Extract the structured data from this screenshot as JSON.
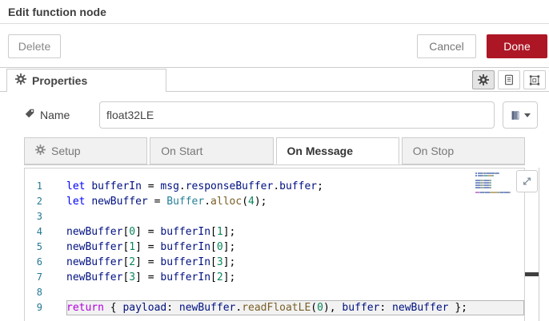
{
  "window": {
    "title": "Edit function node"
  },
  "toolbar": {
    "delete": "Delete",
    "cancel": "Cancel",
    "done": "Done"
  },
  "properties": {
    "label": "Properties"
  },
  "name_field": {
    "label": "Name",
    "value": "float32LE"
  },
  "tabs": [
    {
      "label": "Setup",
      "has_icon": true,
      "active": false
    },
    {
      "label": "On Start",
      "has_icon": false,
      "active": false
    },
    {
      "label": "On Message",
      "has_icon": false,
      "active": true
    },
    {
      "label": "On Stop",
      "has_icon": false,
      "active": false
    }
  ],
  "colors": {
    "accent_red": "#AD1625",
    "keyword": "#0000ff",
    "control_keyword": "#af00db",
    "identifier": "#001080",
    "class_name": "#267f99",
    "function_name": "#795e26",
    "number": "#098658",
    "plain": "#000000",
    "line_number": "#237893"
  },
  "code": {
    "language": "javascript",
    "lines": [
      {
        "num": 1,
        "current": false,
        "tokens": [
          [
            "let",
            "k"
          ],
          [
            " ",
            "p"
          ],
          [
            "bufferIn",
            "v"
          ],
          [
            " = ",
            "p"
          ],
          [
            "msg",
            "v"
          ],
          [
            ".",
            "p"
          ],
          [
            "responseBuffer",
            "v"
          ],
          [
            ".",
            "p"
          ],
          [
            "buffer",
            "v"
          ],
          [
            ";",
            "p"
          ]
        ]
      },
      {
        "num": 2,
        "current": false,
        "tokens": [
          [
            "let",
            "k"
          ],
          [
            " ",
            "p"
          ],
          [
            "newBuffer",
            "v"
          ],
          [
            " = ",
            "p"
          ],
          [
            "Buffer",
            "c"
          ],
          [
            ".",
            "p"
          ],
          [
            "alloc",
            "f"
          ],
          [
            "(",
            "p"
          ],
          [
            "4",
            "n"
          ],
          [
            ");",
            "p"
          ]
        ]
      },
      {
        "num": 3,
        "current": false,
        "tokens": []
      },
      {
        "num": 4,
        "current": false,
        "tokens": [
          [
            "newBuffer",
            "v"
          ],
          [
            "[",
            "p"
          ],
          [
            "0",
            "n"
          ],
          [
            "] = ",
            "p"
          ],
          [
            "bufferIn",
            "v"
          ],
          [
            "[",
            "p"
          ],
          [
            "1",
            "n"
          ],
          [
            "];",
            "p"
          ]
        ]
      },
      {
        "num": 5,
        "current": false,
        "tokens": [
          [
            "newBuffer",
            "v"
          ],
          [
            "[",
            "p"
          ],
          [
            "1",
            "n"
          ],
          [
            "] = ",
            "p"
          ],
          [
            "bufferIn",
            "v"
          ],
          [
            "[",
            "p"
          ],
          [
            "0",
            "n"
          ],
          [
            "];",
            "p"
          ]
        ]
      },
      {
        "num": 6,
        "current": false,
        "tokens": [
          [
            "newBuffer",
            "v"
          ],
          [
            "[",
            "p"
          ],
          [
            "2",
            "n"
          ],
          [
            "] = ",
            "p"
          ],
          [
            "bufferIn",
            "v"
          ],
          [
            "[",
            "p"
          ],
          [
            "3",
            "n"
          ],
          [
            "];",
            "p"
          ]
        ]
      },
      {
        "num": 7,
        "current": false,
        "tokens": [
          [
            "newBuffer",
            "v"
          ],
          [
            "[",
            "p"
          ],
          [
            "3",
            "n"
          ],
          [
            "] = ",
            "p"
          ],
          [
            "bufferIn",
            "v"
          ],
          [
            "[",
            "p"
          ],
          [
            "2",
            "n"
          ],
          [
            "];",
            "p"
          ]
        ]
      },
      {
        "num": 8,
        "current": false,
        "tokens": []
      },
      {
        "num": 9,
        "current": true,
        "tokens": [
          [
            "return",
            "r"
          ],
          [
            " { ",
            "p"
          ],
          [
            "payload",
            "v"
          ],
          [
            ": ",
            "p"
          ],
          [
            "newBuffer",
            "v"
          ],
          [
            ".",
            "p"
          ],
          [
            "readFloatLE",
            "f"
          ],
          [
            "(",
            "p"
          ],
          [
            "0",
            "n"
          ],
          [
            "), ",
            "p"
          ],
          [
            "buffer",
            "v"
          ],
          [
            ": ",
            "p"
          ],
          [
            "newBuffer",
            "v"
          ],
          [
            " };",
            "p"
          ]
        ]
      }
    ]
  }
}
